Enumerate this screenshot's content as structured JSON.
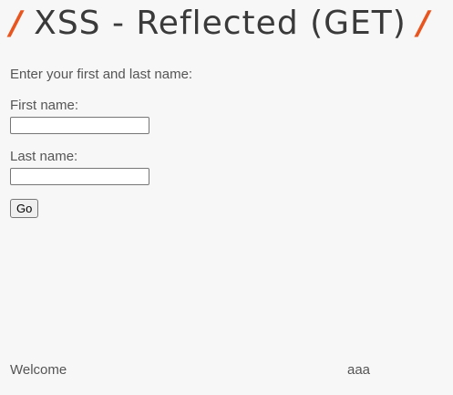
{
  "header": {
    "title": "XSS - Reflected (GET)",
    "slash_left": "/",
    "slash_right": "/",
    "slash_color": "#e8551f"
  },
  "form": {
    "intro": "Enter your first and last name:",
    "first_name_label": "First name:",
    "first_name_value": "",
    "last_name_label": "Last name:",
    "last_name_value": "",
    "submit_label": "Go"
  },
  "result": {
    "welcome_label": "Welcome",
    "name": "aaa"
  }
}
